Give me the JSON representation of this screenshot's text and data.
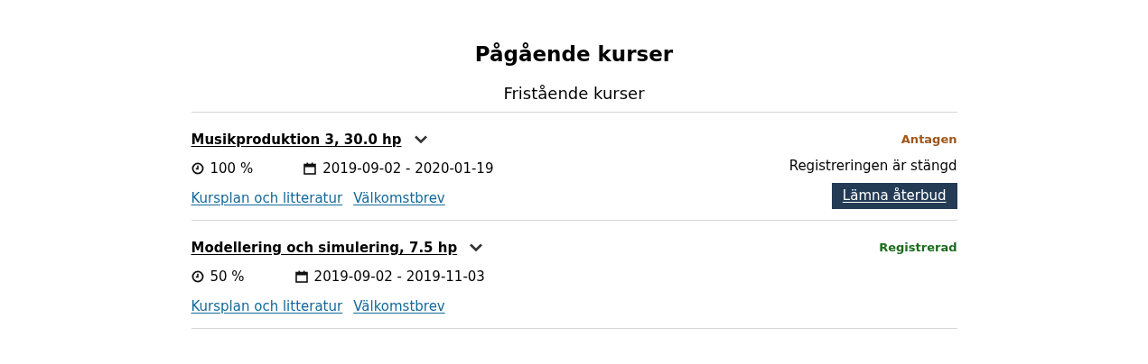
{
  "heading": "Pågående kurser",
  "section": {
    "title": "Fristående kurser",
    "courses": [
      {
        "title": "Musikproduktion 3, 30.0 hp",
        "expanded": false,
        "status": "Antagen",
        "color": "#a0561c",
        "pace": "100 %",
        "dates": "2019-09-02 - 2020-01-19",
        "links": [
          "Kursplan och litteratur",
          "Välkomstbrev"
        ],
        "note": "Registreringen är stängd",
        "action": "Lämna återbud"
      },
      {
        "title": "Modellering och simulering, 7.5 hp",
        "expanded": false,
        "status": "Registrerad",
        "color": "#1e6b1e",
        "pace": "50 %",
        "dates": "2019-09-02 - 2019-11-03",
        "links": [
          "Kursplan och litteratur",
          "Välkomstbrev"
        ]
      }
    ]
  }
}
